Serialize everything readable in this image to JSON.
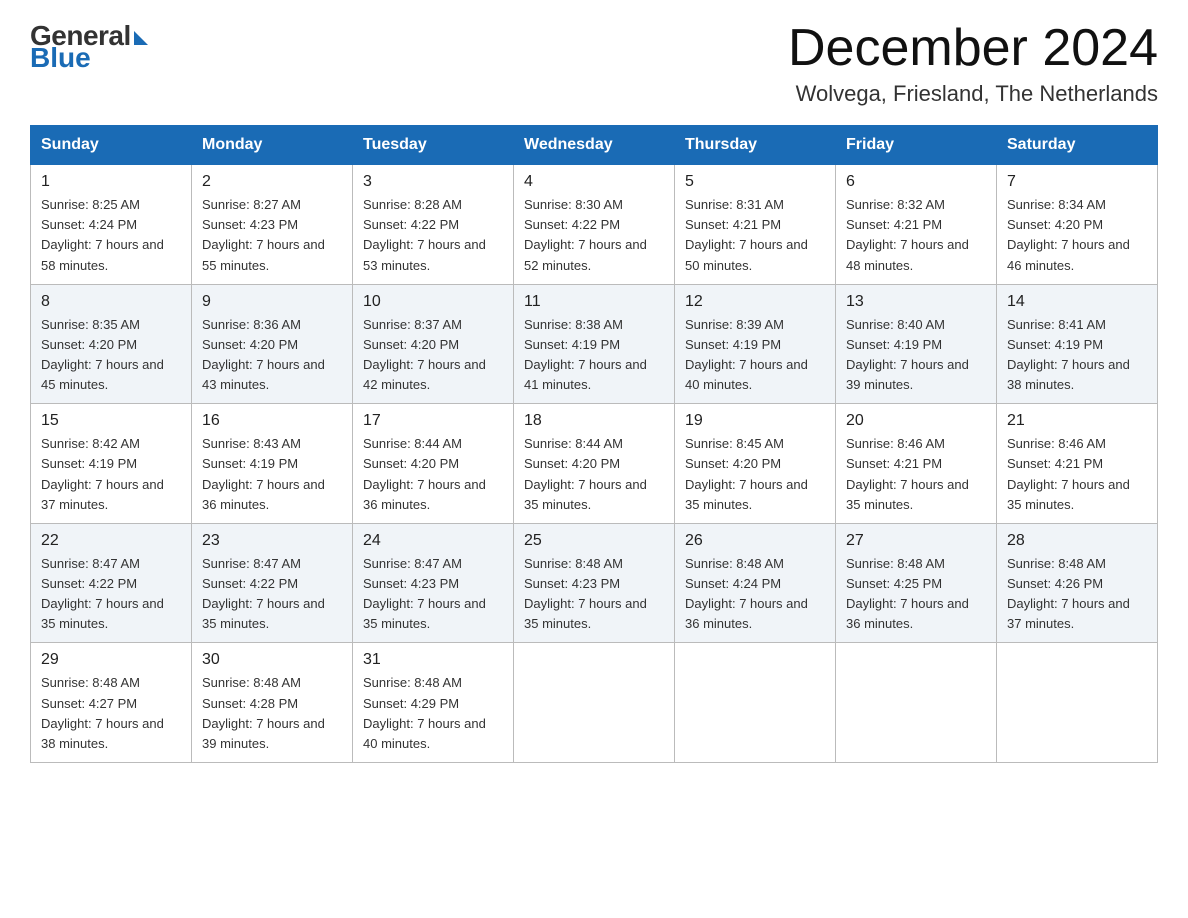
{
  "header": {
    "logo_general": "General",
    "logo_blue": "Blue",
    "month_title": "December 2024",
    "location": "Wolvega, Friesland, The Netherlands"
  },
  "weekdays": [
    "Sunday",
    "Monday",
    "Tuesday",
    "Wednesday",
    "Thursday",
    "Friday",
    "Saturday"
  ],
  "weeks": [
    [
      {
        "day": "1",
        "sunrise": "Sunrise: 8:25 AM",
        "sunset": "Sunset: 4:24 PM",
        "daylight": "Daylight: 7 hours and 58 minutes."
      },
      {
        "day": "2",
        "sunrise": "Sunrise: 8:27 AM",
        "sunset": "Sunset: 4:23 PM",
        "daylight": "Daylight: 7 hours and 55 minutes."
      },
      {
        "day": "3",
        "sunrise": "Sunrise: 8:28 AM",
        "sunset": "Sunset: 4:22 PM",
        "daylight": "Daylight: 7 hours and 53 minutes."
      },
      {
        "day": "4",
        "sunrise": "Sunrise: 8:30 AM",
        "sunset": "Sunset: 4:22 PM",
        "daylight": "Daylight: 7 hours and 52 minutes."
      },
      {
        "day": "5",
        "sunrise": "Sunrise: 8:31 AM",
        "sunset": "Sunset: 4:21 PM",
        "daylight": "Daylight: 7 hours and 50 minutes."
      },
      {
        "day": "6",
        "sunrise": "Sunrise: 8:32 AM",
        "sunset": "Sunset: 4:21 PM",
        "daylight": "Daylight: 7 hours and 48 minutes."
      },
      {
        "day": "7",
        "sunrise": "Sunrise: 8:34 AM",
        "sunset": "Sunset: 4:20 PM",
        "daylight": "Daylight: 7 hours and 46 minutes."
      }
    ],
    [
      {
        "day": "8",
        "sunrise": "Sunrise: 8:35 AM",
        "sunset": "Sunset: 4:20 PM",
        "daylight": "Daylight: 7 hours and 45 minutes."
      },
      {
        "day": "9",
        "sunrise": "Sunrise: 8:36 AM",
        "sunset": "Sunset: 4:20 PM",
        "daylight": "Daylight: 7 hours and 43 minutes."
      },
      {
        "day": "10",
        "sunrise": "Sunrise: 8:37 AM",
        "sunset": "Sunset: 4:20 PM",
        "daylight": "Daylight: 7 hours and 42 minutes."
      },
      {
        "day": "11",
        "sunrise": "Sunrise: 8:38 AM",
        "sunset": "Sunset: 4:19 PM",
        "daylight": "Daylight: 7 hours and 41 minutes."
      },
      {
        "day": "12",
        "sunrise": "Sunrise: 8:39 AM",
        "sunset": "Sunset: 4:19 PM",
        "daylight": "Daylight: 7 hours and 40 minutes."
      },
      {
        "day": "13",
        "sunrise": "Sunrise: 8:40 AM",
        "sunset": "Sunset: 4:19 PM",
        "daylight": "Daylight: 7 hours and 39 minutes."
      },
      {
        "day": "14",
        "sunrise": "Sunrise: 8:41 AM",
        "sunset": "Sunset: 4:19 PM",
        "daylight": "Daylight: 7 hours and 38 minutes."
      }
    ],
    [
      {
        "day": "15",
        "sunrise": "Sunrise: 8:42 AM",
        "sunset": "Sunset: 4:19 PM",
        "daylight": "Daylight: 7 hours and 37 minutes."
      },
      {
        "day": "16",
        "sunrise": "Sunrise: 8:43 AM",
        "sunset": "Sunset: 4:19 PM",
        "daylight": "Daylight: 7 hours and 36 minutes."
      },
      {
        "day": "17",
        "sunrise": "Sunrise: 8:44 AM",
        "sunset": "Sunset: 4:20 PM",
        "daylight": "Daylight: 7 hours and 36 minutes."
      },
      {
        "day": "18",
        "sunrise": "Sunrise: 8:44 AM",
        "sunset": "Sunset: 4:20 PM",
        "daylight": "Daylight: 7 hours and 35 minutes."
      },
      {
        "day": "19",
        "sunrise": "Sunrise: 8:45 AM",
        "sunset": "Sunset: 4:20 PM",
        "daylight": "Daylight: 7 hours and 35 minutes."
      },
      {
        "day": "20",
        "sunrise": "Sunrise: 8:46 AM",
        "sunset": "Sunset: 4:21 PM",
        "daylight": "Daylight: 7 hours and 35 minutes."
      },
      {
        "day": "21",
        "sunrise": "Sunrise: 8:46 AM",
        "sunset": "Sunset: 4:21 PM",
        "daylight": "Daylight: 7 hours and 35 minutes."
      }
    ],
    [
      {
        "day": "22",
        "sunrise": "Sunrise: 8:47 AM",
        "sunset": "Sunset: 4:22 PM",
        "daylight": "Daylight: 7 hours and 35 minutes."
      },
      {
        "day": "23",
        "sunrise": "Sunrise: 8:47 AM",
        "sunset": "Sunset: 4:22 PM",
        "daylight": "Daylight: 7 hours and 35 minutes."
      },
      {
        "day": "24",
        "sunrise": "Sunrise: 8:47 AM",
        "sunset": "Sunset: 4:23 PM",
        "daylight": "Daylight: 7 hours and 35 minutes."
      },
      {
        "day": "25",
        "sunrise": "Sunrise: 8:48 AM",
        "sunset": "Sunset: 4:23 PM",
        "daylight": "Daylight: 7 hours and 35 minutes."
      },
      {
        "day": "26",
        "sunrise": "Sunrise: 8:48 AM",
        "sunset": "Sunset: 4:24 PM",
        "daylight": "Daylight: 7 hours and 36 minutes."
      },
      {
        "day": "27",
        "sunrise": "Sunrise: 8:48 AM",
        "sunset": "Sunset: 4:25 PM",
        "daylight": "Daylight: 7 hours and 36 minutes."
      },
      {
        "day": "28",
        "sunrise": "Sunrise: 8:48 AM",
        "sunset": "Sunset: 4:26 PM",
        "daylight": "Daylight: 7 hours and 37 minutes."
      }
    ],
    [
      {
        "day": "29",
        "sunrise": "Sunrise: 8:48 AM",
        "sunset": "Sunset: 4:27 PM",
        "daylight": "Daylight: 7 hours and 38 minutes."
      },
      {
        "day": "30",
        "sunrise": "Sunrise: 8:48 AM",
        "sunset": "Sunset: 4:28 PM",
        "daylight": "Daylight: 7 hours and 39 minutes."
      },
      {
        "day": "31",
        "sunrise": "Sunrise: 8:48 AM",
        "sunset": "Sunset: 4:29 PM",
        "daylight": "Daylight: 7 hours and 40 minutes."
      },
      null,
      null,
      null,
      null
    ]
  ]
}
